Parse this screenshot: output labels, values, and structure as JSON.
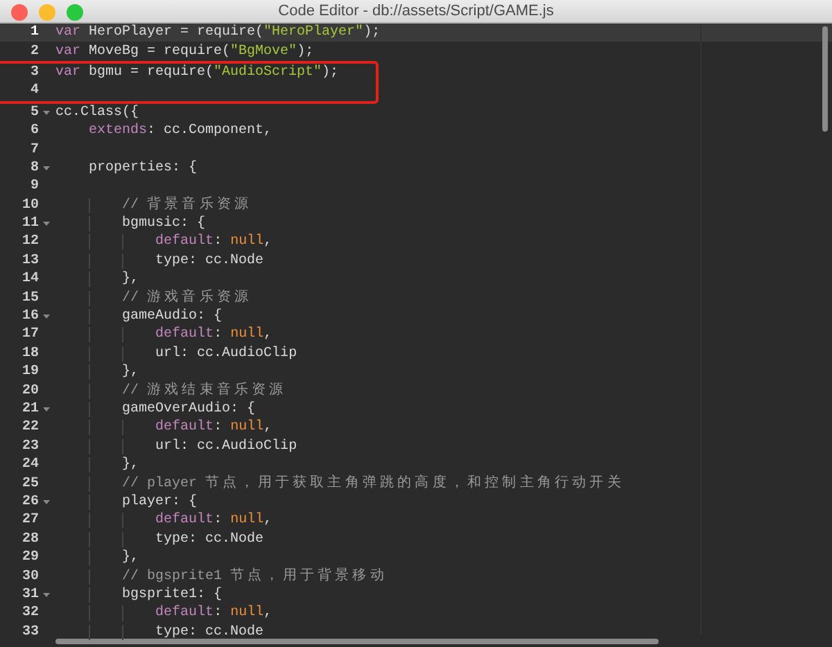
{
  "window": {
    "title": "Code Editor - db://assets/Script/GAME.js"
  },
  "lines": [
    {
      "number": "1",
      "active": true,
      "foldable": false,
      "boxed": false,
      "tokens": [
        {
          "text": "var",
          "kind": "keyword"
        },
        {
          "text": " HeroPlayer = require(",
          "kind": "plain"
        },
        {
          "text": "\"HeroPlayer\"",
          "kind": "string"
        },
        {
          "text": ");",
          "kind": "plain"
        }
      ]
    },
    {
      "number": "2",
      "active": false,
      "foldable": false,
      "boxed": false,
      "tokens": [
        {
          "text": "var",
          "kind": "keyword"
        },
        {
          "text": " MoveBg = require(",
          "kind": "plain"
        },
        {
          "text": "\"BgMove\"",
          "kind": "string"
        },
        {
          "text": ");",
          "kind": "plain"
        }
      ]
    },
    {
      "number": "3",
      "active": false,
      "foldable": false,
      "boxed": true,
      "tokens": [
        {
          "text": "var",
          "kind": "keyword"
        },
        {
          "text": " bgmu = require(",
          "kind": "plain"
        },
        {
          "text": "\"AudioScript\"",
          "kind": "string"
        },
        {
          "text": ");",
          "kind": "plain"
        }
      ]
    },
    {
      "number": "4",
      "active": false,
      "foldable": false,
      "boxed": true
    },
    {
      "number": "5",
      "active": false,
      "foldable": true,
      "boxed": false,
      "tokens": [
        {
          "text": "cc.Class({",
          "kind": "plain"
        }
      ]
    },
    {
      "number": "6",
      "active": false,
      "foldable": false,
      "boxed": false,
      "tokens": [
        {
          "text": "    extends",
          "kind": "keyword"
        },
        {
          "text": ": cc.Component,",
          "kind": "plain"
        }
      ]
    },
    {
      "number": "7",
      "active": false,
      "foldable": false,
      "boxed": false
    },
    {
      "number": "8",
      "active": false,
      "foldable": true,
      "boxed": false,
      "tokens": [
        {
          "text": "    properties: {",
          "kind": "plain"
        }
      ]
    },
    {
      "number": "9",
      "active": false,
      "foldable": false,
      "boxed": false
    },
    {
      "number": "10",
      "active": false,
      "foldable": false,
      "boxed": false,
      "tokens": [
        {
          "text": "        // 背景音乐资源",
          "kind": "comment"
        }
      ]
    },
    {
      "number": "11",
      "active": false,
      "foldable": true,
      "boxed": false,
      "tokens": [
        {
          "text": "        bgmusic: {",
          "kind": "plain"
        }
      ]
    },
    {
      "number": "12",
      "active": false,
      "foldable": false,
      "boxed": false,
      "tokens": [
        {
          "text": "            default",
          "kind": "keyword"
        },
        {
          "text": ": ",
          "kind": "plain"
        },
        {
          "text": "null",
          "kind": "literal"
        },
        {
          "text": ",",
          "kind": "plain"
        }
      ]
    },
    {
      "number": "13",
      "active": false,
      "foldable": false,
      "boxed": false,
      "tokens": [
        {
          "text": "            type: cc.Node",
          "kind": "plain"
        }
      ]
    },
    {
      "number": "14",
      "active": false,
      "foldable": false,
      "boxed": false,
      "tokens": [
        {
          "text": "        },",
          "kind": "plain"
        }
      ]
    },
    {
      "number": "15",
      "active": false,
      "foldable": false,
      "boxed": false,
      "tokens": [
        {
          "text": "        // 游戏音乐资源",
          "kind": "comment"
        }
      ]
    },
    {
      "number": "16",
      "active": false,
      "foldable": true,
      "boxed": false,
      "tokens": [
        {
          "text": "        gameAudio: {",
          "kind": "plain"
        }
      ]
    },
    {
      "number": "17",
      "active": false,
      "foldable": false,
      "boxed": false,
      "tokens": [
        {
          "text": "            default",
          "kind": "keyword"
        },
        {
          "text": ": ",
          "kind": "plain"
        },
        {
          "text": "null",
          "kind": "literal"
        },
        {
          "text": ",",
          "kind": "plain"
        }
      ]
    },
    {
      "number": "18",
      "active": false,
      "foldable": false,
      "boxed": false,
      "tokens": [
        {
          "text": "            url: cc.AudioClip",
          "kind": "plain"
        }
      ]
    },
    {
      "number": "19",
      "active": false,
      "foldable": false,
      "boxed": false,
      "tokens": [
        {
          "text": "        },",
          "kind": "plain"
        }
      ]
    },
    {
      "number": "20",
      "active": false,
      "foldable": false,
      "boxed": false,
      "tokens": [
        {
          "text": "        // 游戏结束音乐资源",
          "kind": "comment"
        }
      ]
    },
    {
      "number": "21",
      "active": false,
      "foldable": true,
      "boxed": false,
      "tokens": [
        {
          "text": "        gameOverAudio: {",
          "kind": "plain"
        }
      ]
    },
    {
      "number": "22",
      "active": false,
      "foldable": false,
      "boxed": false,
      "tokens": [
        {
          "text": "            default",
          "kind": "keyword"
        },
        {
          "text": ": ",
          "kind": "plain"
        },
        {
          "text": "null",
          "kind": "literal"
        },
        {
          "text": ",",
          "kind": "plain"
        }
      ]
    },
    {
      "number": "23",
      "active": false,
      "foldable": false,
      "boxed": false,
      "tokens": [
        {
          "text": "            url: cc.AudioClip",
          "kind": "plain"
        }
      ]
    },
    {
      "number": "24",
      "active": false,
      "foldable": false,
      "boxed": false,
      "tokens": [
        {
          "text": "        },",
          "kind": "plain"
        }
      ]
    },
    {
      "number": "25",
      "active": false,
      "foldable": false,
      "boxed": false,
      "tokens": [
        {
          "text": "        // player 节点，用于获取主角弹跳的高度，和控制主角行动开关",
          "kind": "comment"
        }
      ]
    },
    {
      "number": "26",
      "active": false,
      "foldable": true,
      "boxed": false,
      "tokens": [
        {
          "text": "        player: {",
          "kind": "plain"
        }
      ]
    },
    {
      "number": "27",
      "active": false,
      "foldable": false,
      "boxed": false,
      "tokens": [
        {
          "text": "            default",
          "kind": "keyword"
        },
        {
          "text": ": ",
          "kind": "plain"
        },
        {
          "text": "null",
          "kind": "literal"
        },
        {
          "text": ",",
          "kind": "plain"
        }
      ]
    },
    {
      "number": "28",
      "active": false,
      "foldable": false,
      "boxed": false,
      "tokens": [
        {
          "text": "            type: cc.Node",
          "kind": "plain"
        }
      ]
    },
    {
      "number": "29",
      "active": false,
      "foldable": false,
      "boxed": false,
      "tokens": [
        {
          "text": "        },",
          "kind": "plain"
        }
      ]
    },
    {
      "number": "30",
      "active": false,
      "foldable": false,
      "boxed": false,
      "tokens": [
        {
          "text": "        // bgsprite1 节点，用于背景移动",
          "kind": "comment"
        }
      ]
    },
    {
      "number": "31",
      "active": false,
      "foldable": true,
      "boxed": false,
      "tokens": [
        {
          "text": "        bgsprite1: {",
          "kind": "plain"
        }
      ]
    },
    {
      "number": "32",
      "active": false,
      "foldable": false,
      "boxed": false,
      "tokens": [
        {
          "text": "            default",
          "kind": "keyword"
        },
        {
          "text": ": ",
          "kind": "plain"
        },
        {
          "text": "null",
          "kind": "literal"
        },
        {
          "text": ",",
          "kind": "plain"
        }
      ]
    },
    {
      "number": "33",
      "active": false,
      "foldable": false,
      "boxed": false,
      "tokens": [
        {
          "text": "            type: cc.Node",
          "kind": "plain"
        }
      ]
    }
  ]
}
